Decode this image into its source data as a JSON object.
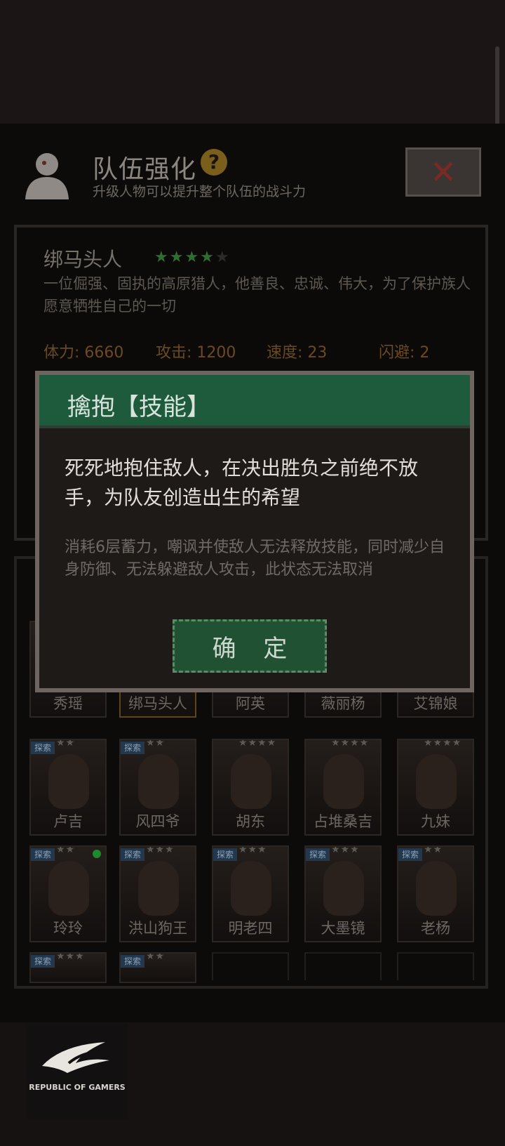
{
  "header": {
    "title": "队伍强化",
    "help_icon": "?",
    "subtitle": "升级人物可以提升整个队伍的战斗力",
    "close_icon": "close-x"
  },
  "character": {
    "name": "绑马头人",
    "stars_filled": 4,
    "stars_total": 5,
    "description": "一位倔强、固执的高原猎人，他善良、忠诚、伟大，为了保护族人愿意牺牲自己的一切",
    "stats": [
      {
        "label": "体力: 6660"
      },
      {
        "label": "攻击: 1200"
      },
      {
        "label": "速度: 23"
      },
      {
        "label": "闪避: 2"
      }
    ]
  },
  "roster": {
    "row1": [
      "秀瑶",
      "绑马头人",
      "阿英",
      "薇丽杨",
      "艾锦娘"
    ],
    "row2": [
      {
        "name": "卢吉",
        "stars": "★★",
        "tag": "探索"
      },
      {
        "name": "风四爷",
        "stars": "★★",
        "tag": "探索"
      },
      {
        "name": "胡东",
        "stars": "★★★★",
        "tag": ""
      },
      {
        "name": "占堆桑吉",
        "stars": "★★★★",
        "tag": ""
      },
      {
        "name": "九妹",
        "stars": "★★★★",
        "tag": ""
      }
    ],
    "row3": [
      {
        "name": "玲玲",
        "stars": "★★",
        "tag": "探索"
      },
      {
        "name": "洪山狗王",
        "stars": "★★★",
        "tag": "探索"
      },
      {
        "name": "明老四",
        "stars": "★★★",
        "tag": "探索"
      },
      {
        "name": "大墨镜",
        "stars": "★★★",
        "tag": "探索"
      },
      {
        "name": "老杨",
        "stars": "★★",
        "tag": "探索"
      }
    ],
    "row4": [
      {
        "stars": "★★★",
        "tag": "探索"
      },
      {
        "stars": "★★",
        "tag": "探索"
      }
    ]
  },
  "dialog": {
    "title": "擒抱【技能】",
    "main_text": "死死地抱住敌人，在决出胜负之前绝不放手，为队友创造出生的希望",
    "detail_text": "消耗6层蓄力，嘲讽并使敌人无法释放技能，同时减少自身防御、无法躲避敌人攻击，此状态无法取消",
    "confirm_label": "确 定"
  },
  "brand": {
    "text": "REPUBLIC OF GAMERS"
  }
}
